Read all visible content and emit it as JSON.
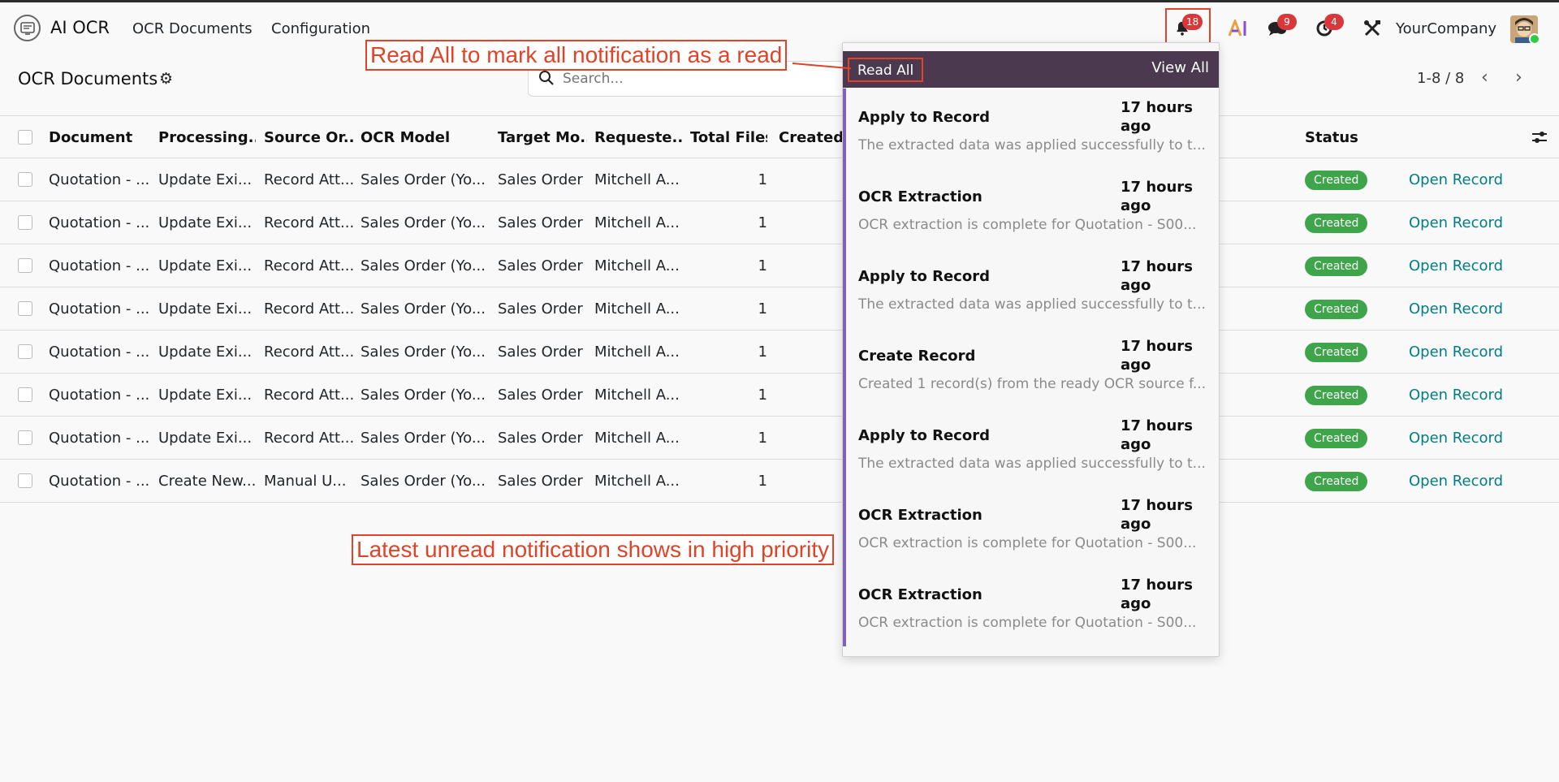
{
  "app": {
    "name": "AI OCR"
  },
  "nav": {
    "documents": "OCR Documents",
    "configuration": "Configuration"
  },
  "systray": {
    "notifications_count": "18",
    "chat_count": "9",
    "activity_count": "4",
    "company": "YourCompany"
  },
  "page": {
    "title": "OCR Documents",
    "search_placeholder": "Search...",
    "pager": "1-8 / 8"
  },
  "table": {
    "headers": {
      "document": "Document",
      "processing": "Processing...",
      "source": "Source Or...",
      "model": "OCR Model",
      "target": "Target Mo...",
      "requested": "Requeste...",
      "files": "Total Files",
      "created": "Created",
      "status": "Status"
    },
    "rows": [
      {
        "document": "Quotation - ...",
        "processing": "Update Exi...",
        "source": "Record Att...",
        "model": "Sales Order (Yo...",
        "target": "Sales Order",
        "requested": "Mitchell A...",
        "files": "1",
        "status": "Created",
        "action": "Open Record"
      },
      {
        "document": "Quotation - ...",
        "processing": "Update Exi...",
        "source": "Record Att...",
        "model": "Sales Order (Yo...",
        "target": "Sales Order",
        "requested": "Mitchell A...",
        "files": "1",
        "status": "Created",
        "action": "Open Record"
      },
      {
        "document": "Quotation - ...",
        "processing": "Update Exi...",
        "source": "Record Att...",
        "model": "Sales Order (Yo...",
        "target": "Sales Order",
        "requested": "Mitchell A...",
        "files": "1",
        "status": "Created",
        "action": "Open Record"
      },
      {
        "document": "Quotation - ...",
        "processing": "Update Exi...",
        "source": "Record Att...",
        "model": "Sales Order (Yo...",
        "target": "Sales Order",
        "requested": "Mitchell A...",
        "files": "1",
        "status": "Created",
        "action": "Open Record"
      },
      {
        "document": "Quotation - ...",
        "processing": "Update Exi...",
        "source": "Record Att...",
        "model": "Sales Order (Yo...",
        "target": "Sales Order",
        "requested": "Mitchell A...",
        "files": "1",
        "status": "Created",
        "action": "Open Record"
      },
      {
        "document": "Quotation - ...",
        "processing": "Update Exi...",
        "source": "Record Att...",
        "model": "Sales Order (Yo...",
        "target": "Sales Order",
        "requested": "Mitchell A...",
        "files": "1",
        "status": "Created",
        "action": "Open Record"
      },
      {
        "document": "Quotation - ...",
        "processing": "Update Exi...",
        "source": "Record Att...",
        "model": "Sales Order (Yo...",
        "target": "Sales Order",
        "requested": "Mitchell A...",
        "files": "1",
        "status": "Created",
        "action": "Open Record"
      },
      {
        "document": "Quotation - ...",
        "processing": "Create New...",
        "source": "Manual U...",
        "model": "Sales Order (Yo...",
        "target": "Sales Order",
        "requested": "Mitchell A...",
        "files": "1",
        "status": "Created",
        "action": "Open Record"
      }
    ]
  },
  "notifications": {
    "read_all": "Read All",
    "view_all": "View All",
    "items": [
      {
        "title": "Apply to Record",
        "time": "17 hours ago",
        "desc": "The extracted data was applied successfully to t..."
      },
      {
        "title": "OCR Extraction",
        "time": "17 hours ago",
        "desc": "OCR extraction is complete for Quotation - S00..."
      },
      {
        "title": "Apply to Record",
        "time": "17 hours ago",
        "desc": "The extracted data was applied successfully to t..."
      },
      {
        "title": "Create Record",
        "time": "17 hours ago",
        "desc": "Created 1 record(s) from the ready OCR source f..."
      },
      {
        "title": "Apply to Record",
        "time": "17 hours ago",
        "desc": "The extracted data was applied successfully to t..."
      },
      {
        "title": "OCR Extraction",
        "time": "17 hours ago",
        "desc": "OCR extraction is complete for Quotation - S00..."
      },
      {
        "title": "OCR Extraction",
        "time": "17 hours ago",
        "desc": "OCR extraction is complete for Quotation - S00..."
      }
    ]
  },
  "annotations": {
    "read_all_note": "Read All to mark all notification as a read",
    "priority_note": "Latest unread notification shows in high priority"
  }
}
